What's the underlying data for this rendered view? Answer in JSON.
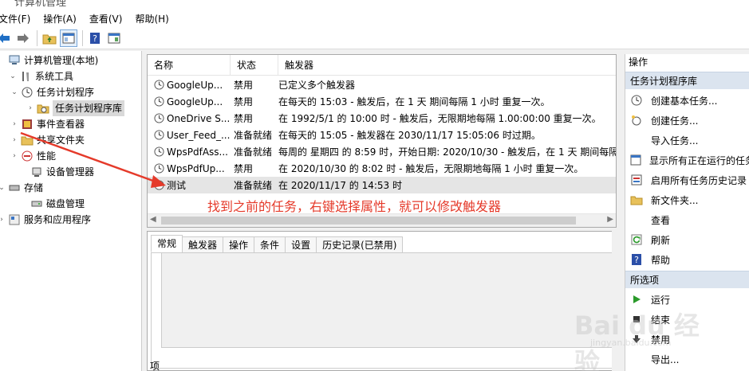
{
  "window": {
    "title": "计算机管理"
  },
  "menu": [
    {
      "label": "文件(F)"
    },
    {
      "label": "操作(A)"
    },
    {
      "label": "查看(V)"
    },
    {
      "label": "帮助(H)"
    }
  ],
  "tree": {
    "root": "计算机管理(本地)",
    "system_tools": "系统工具",
    "task_scheduler": "任务计划程序",
    "task_library": "任务计划程序库",
    "event_viewer": "事件查看器",
    "shared_folders": "共享文件夹",
    "performance": "性能",
    "device_manager": "设备管理器",
    "storage": "存储",
    "disk_management": "磁盘管理",
    "services_apps": "服务和应用程序"
  },
  "tasklist": {
    "columns": [
      "名称",
      "状态",
      "触发器"
    ],
    "rows": [
      {
        "name": "GoogleUp...",
        "status": "禁用",
        "trigger": "已定义多个触发器"
      },
      {
        "name": "GoogleUp...",
        "status": "禁用",
        "trigger": "在每天的 15:03 - 触发后，在 1 天 期间每隔 1 小时 重复一次。"
      },
      {
        "name": "OneDrive S...",
        "status": "禁用",
        "trigger": "在 1992/5/1 的 10:00 时 - 触发后，无限期地每隔 1.00:00:00 重复一次。"
      },
      {
        "name": "User_Feed_...",
        "status": "准备就绪",
        "trigger": "在每天的 15:05 - 触发器在 2030/11/17 15:05:06 时过期。"
      },
      {
        "name": "WpsPdfAss...",
        "status": "准备就绪",
        "trigger": "每周的 星期四 的 8:59 时，开始日期: 2020/10/30 - 触发后，在 1 天 期间每隔"
      },
      {
        "name": "WpsPdfUp...",
        "status": "禁用",
        "trigger": "在 2020/10/30 的 8:02 时 - 触发后，无限期地每隔 1 小时 重复一次。"
      },
      {
        "name": "测试",
        "status": "准备就绪",
        "trigger": "在 2020/11/17 的 14:53 时"
      }
    ]
  },
  "annotation": "找到之前的任务，右键选择属性，就可以修改触发器",
  "details": {
    "tabs": [
      "常规",
      "触发器",
      "操作",
      "条件",
      "设置",
      "历史记录(已禁用)"
    ],
    "field_label": "项"
  },
  "actions": {
    "title": "操作",
    "section1": "任务计划程序库",
    "items1": [
      {
        "label": "创建基本任务...",
        "icon": "wizard-icon"
      },
      {
        "label": "创建任务...",
        "icon": "create-task-icon"
      },
      {
        "label": "导入任务...",
        "icon": "blank-icon"
      },
      {
        "label": "显示所有正在运行的任务",
        "icon": "running-tasks-icon"
      },
      {
        "label": "启用所有任务历史记录",
        "icon": "history-icon"
      },
      {
        "label": "新文件夹...",
        "icon": "folder-icon"
      },
      {
        "label": "查看",
        "icon": "blank-icon"
      },
      {
        "label": "刷新",
        "icon": "refresh-icon"
      },
      {
        "label": "帮助",
        "icon": "help-icon"
      }
    ],
    "section2": "所选项",
    "items2": [
      {
        "label": "运行",
        "icon": "run-icon"
      },
      {
        "label": "结束",
        "icon": "end-icon"
      },
      {
        "label": "禁用",
        "icon": "disable-icon"
      },
      {
        "label": "导出...",
        "icon": "blank-icon"
      }
    ]
  },
  "watermark": {
    "brand": "Bai du 经验",
    "url": "jingyan.baidu.com"
  },
  "colors": {
    "annotation": "#e53a2a",
    "selection": "#e5e5e5",
    "section_header": "#dbe4ef"
  }
}
